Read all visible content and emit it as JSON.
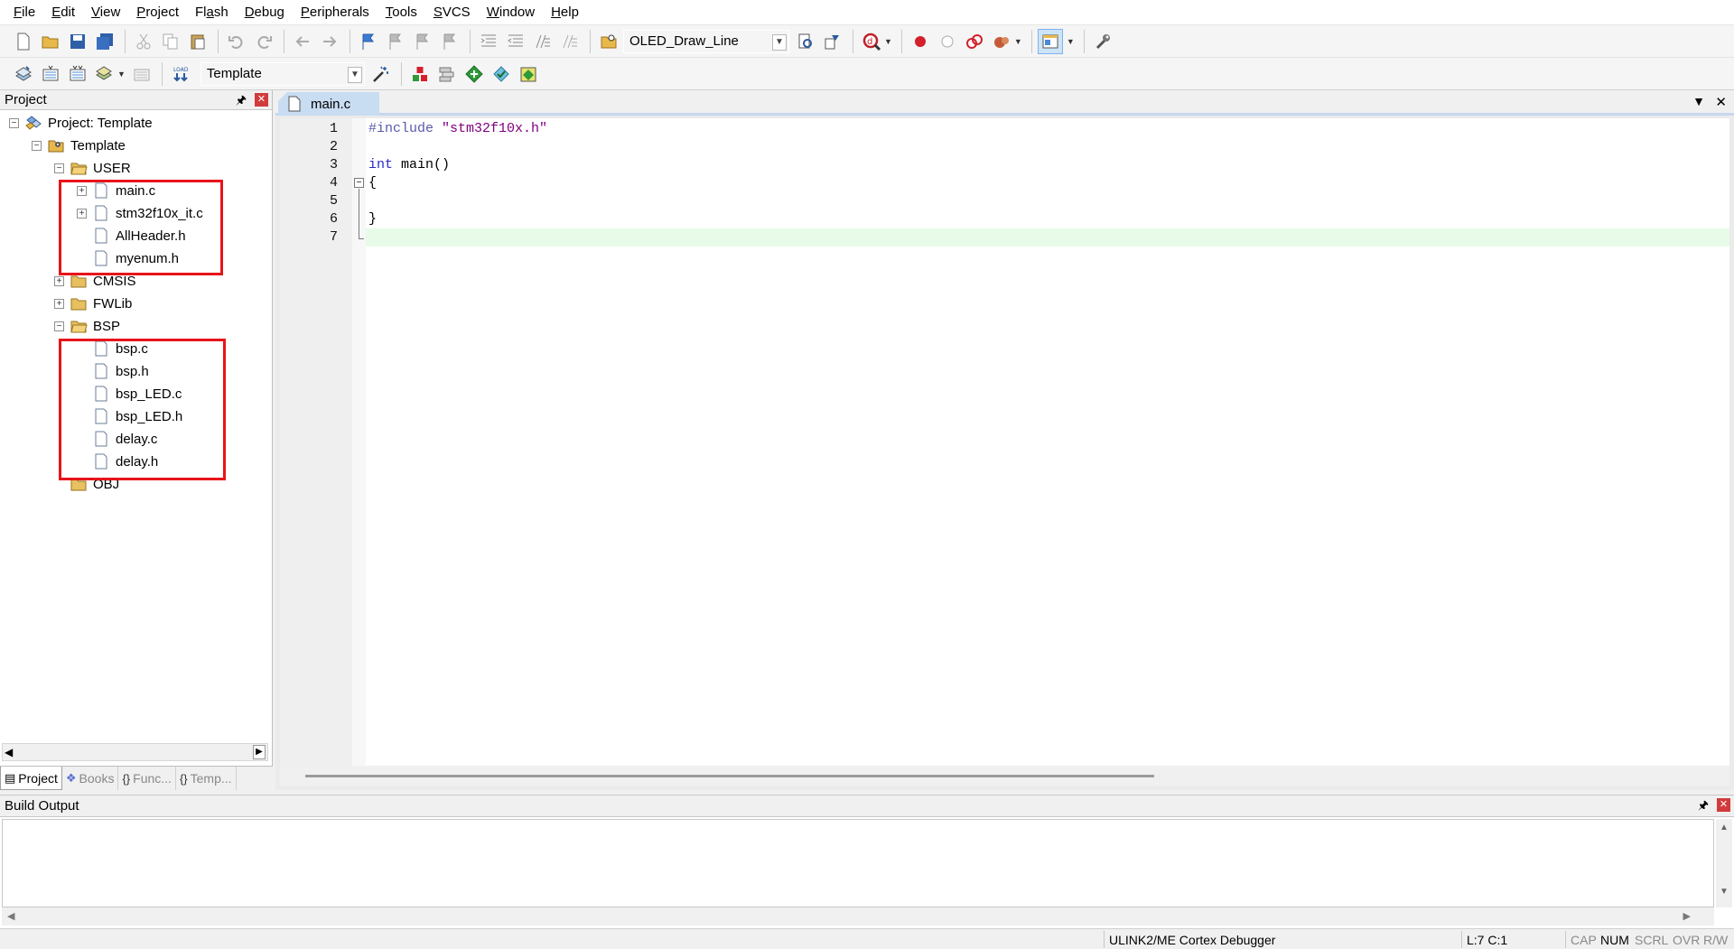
{
  "menu": [
    "File",
    "Edit",
    "View",
    "Project",
    "Flash",
    "Debug",
    "Peripherals",
    "Tools",
    "SVCS",
    "Window",
    "Help"
  ],
  "menu_underline": [
    "F",
    "E",
    "V",
    "P",
    "a",
    "D",
    "P",
    "T",
    "S",
    "W",
    "H"
  ],
  "toolbar": {
    "find_combo_value": "OLED_Draw_Line",
    "target_combo_value": "Template"
  },
  "project_panel": {
    "title": "Project",
    "root": "Project: Template",
    "target": "Template",
    "groups": {
      "user": {
        "label": "USER",
        "files": [
          "main.c",
          "stm32f10x_it.c",
          "AllHeader.h",
          "myenum.h"
        ]
      },
      "cmsis": {
        "label": "CMSIS"
      },
      "fwlib": {
        "label": "FWLib"
      },
      "bsp": {
        "label": "BSP",
        "files": [
          "bsp.c",
          "bsp.h",
          "bsp_LED.c",
          "bsp_LED.h",
          "delay.c",
          "delay.h"
        ]
      },
      "obj": {
        "label": "OBJ"
      }
    },
    "tabs": [
      "Project",
      "Books",
      "Func...",
      "Temp..."
    ]
  },
  "editor": {
    "tab": "main.c",
    "line_numbers": [
      "1",
      "2",
      "3",
      "4",
      "5",
      "6",
      "7"
    ],
    "lines": {
      "l1_pre": "#include",
      "l1_str": "\"stm32f10x.h\"",
      "l3_kw": "int",
      "l3_rest": "main()",
      "l4": "{",
      "l6": "}"
    }
  },
  "build_output": {
    "title": "Build Output"
  },
  "status": {
    "debugger": "ULINK2/ME Cortex Debugger",
    "position": "L:7 C:1",
    "cap": "CAP",
    "num": "NUM",
    "scrl": "SCRL",
    "ovr": "OVR",
    "rw": "R/W"
  },
  "colors": {
    "highlight_box": "#e8141a",
    "current_line": "#e8fbe8",
    "tab_active": "#c8dcf2"
  }
}
